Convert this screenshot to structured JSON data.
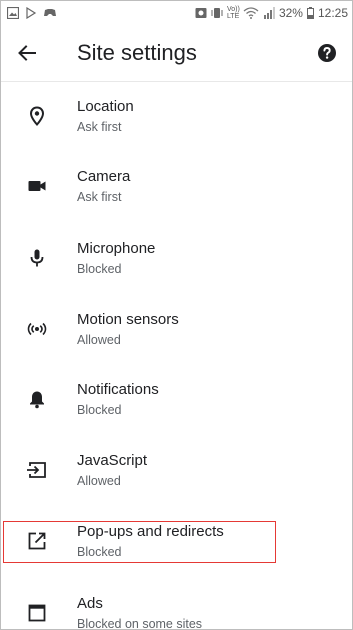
{
  "status_bar": {
    "battery": "32%",
    "time": "12:25",
    "icons": [
      "image-icon",
      "play-store-icon",
      "game-controller-icon",
      "alarm-icon",
      "vibrate-icon",
      "volte-icon",
      "wifi-icon",
      "signal-icon",
      "battery-icon"
    ],
    "volte_label": "Vo)) LTE"
  },
  "app_bar": {
    "title": "Site settings",
    "back_icon": "arrow-back-icon",
    "help_icon": "help-icon"
  },
  "settings": {
    "items": [
      {
        "label": "Location",
        "status": "Ask first",
        "icon": "location-pin-icon"
      },
      {
        "label": "Camera",
        "status": "Ask first",
        "icon": "camera-icon"
      },
      {
        "label": "Microphone",
        "status": "Blocked",
        "icon": "microphone-icon"
      },
      {
        "label": "Motion sensors",
        "status": "Allowed",
        "icon": "motion-sensors-icon"
      },
      {
        "label": "Notifications",
        "status": "Blocked",
        "icon": "bell-icon"
      },
      {
        "label": "JavaScript",
        "status": "Allowed",
        "icon": "javascript-icon"
      },
      {
        "label": "Pop-ups and redirects",
        "status": "Blocked",
        "icon": "open-in-new-icon",
        "highlighted": true
      },
      {
        "label": "Ads",
        "status": "Blocked on some sites",
        "icon": "ads-window-icon"
      }
    ]
  },
  "colors": {
    "highlight_border": "#e53935",
    "title_text": "#202124",
    "subtitle_text": "#5f6368",
    "icon": "#202124"
  }
}
